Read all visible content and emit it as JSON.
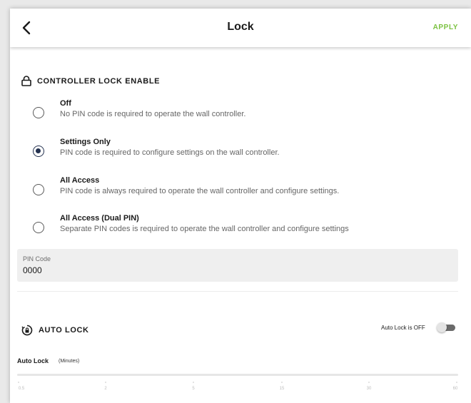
{
  "header": {
    "title": "Lock",
    "apply_label": "APPLY"
  },
  "controller_lock": {
    "section_label": "CONTROLLER LOCK ENABLE",
    "selected": "Settings Only",
    "options": [
      {
        "title": "Off",
        "description": "No PIN code is required to operate the wall controller."
      },
      {
        "title": "Settings Only",
        "description": "PIN code is required to configure settings on the wall controller."
      },
      {
        "title": "All Access",
        "description": "PIN code is always required to operate the wall controller and configure settings."
      },
      {
        "title": "All Access (Dual PIN)",
        "description": "Separate PIN codes is required to operate the wall controller and configure settings"
      }
    ]
  },
  "pin": {
    "label": "PIN Code",
    "value": "0000"
  },
  "auto_lock": {
    "section_label": "AUTO LOCK",
    "status_text": "Auto Lock is OFF",
    "enabled": false,
    "slider_label": "Auto Lock",
    "slider_unit": "(Minutes)",
    "ticks": [
      "0.5",
      "2",
      "5",
      "15",
      "30",
      "60"
    ]
  },
  "colors": {
    "accent": "#7cc242",
    "radio_selected": "#24314f",
    "pin_bg": "#efefef"
  },
  "icons": {
    "back": "chevron-left-icon",
    "lock": "lock-icon",
    "auto_lock": "timer-lock-icon"
  }
}
